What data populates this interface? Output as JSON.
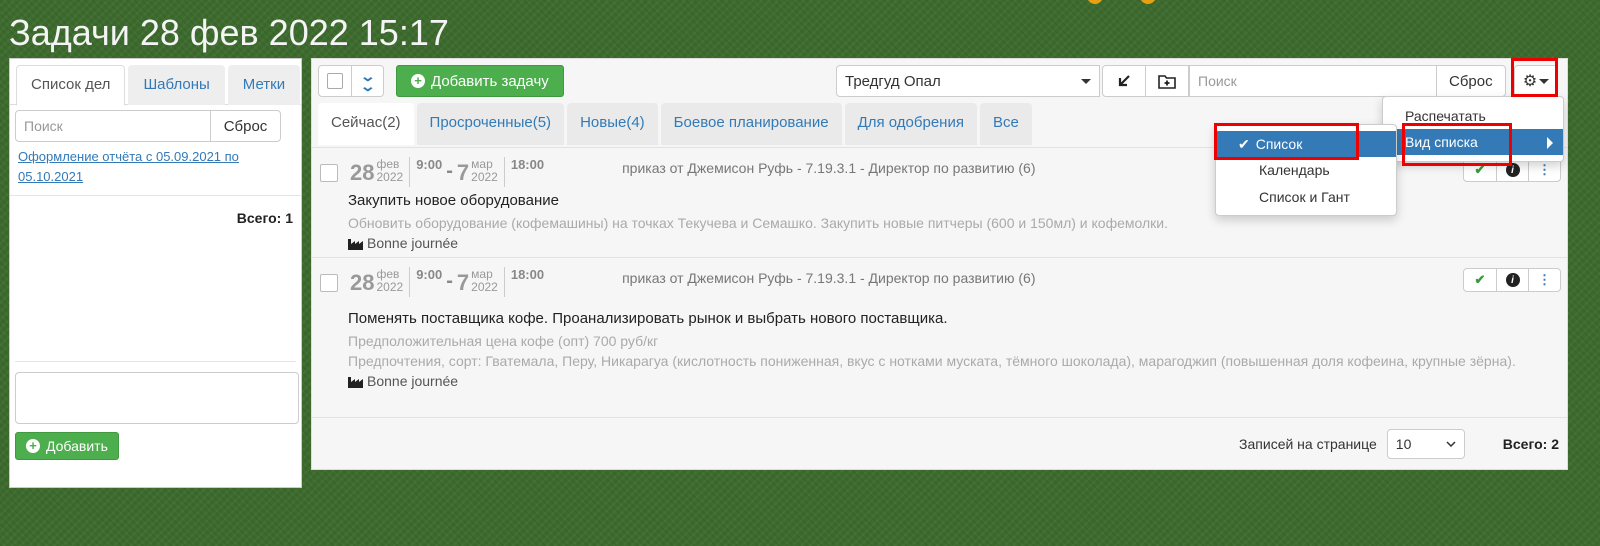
{
  "page_title": "Задачи 28 фев 2022 15:17",
  "left": {
    "tabs": [
      "Список дел",
      "Шаблоны",
      "Метки"
    ],
    "search_placeholder": "Поиск",
    "reset_label": "Сброс",
    "link_text": "Оформление отчёта с 05.09.2021 по 05.10.2021",
    "total": "Всего: 1",
    "add_label": "Добавить"
  },
  "toolbar": {
    "add_task_label": "Добавить задачу",
    "person": "Тредгуд Опал",
    "search_placeholder": "Поиск",
    "reset_label": "Сброс"
  },
  "tabs": [
    "Сейчас(2)",
    "Просроченные(5)",
    "Новые(4)",
    "Боевое планирование",
    "Для одобрения",
    "Все"
  ],
  "tasks": [
    {
      "day_start": "28",
      "month_start": "фев",
      "year_start": "2022",
      "time_start": "9:00",
      "day_end": "7",
      "month_end": "мар",
      "year_end": "2022",
      "time_end": "18:00",
      "order": "приказ от Джемисон Руфь - 7.19.3.1 - Директор по развитию (6)",
      "title": "Закупить новое оборудование",
      "desc": "Обновить оборудование (кофемашины) на точках Текучева и Семашко. Закупить новые питчеры (600 и 150мл) и кофемолки.",
      "project": "Bonne journée"
    },
    {
      "day_start": "28",
      "month_start": "фев",
      "year_start": "2022",
      "time_start": "9:00",
      "day_end": "7",
      "month_end": "мар",
      "year_end": "2022",
      "time_end": "18:00",
      "order": "приказ от Джемисон Руфь - 7.19.3.1 - Директор по развитию (6)",
      "title": "Поменять поставщика кофе. Проанализировать рынок и выбрать нового поставщика.",
      "desc": "Предположительная цена кофе (опт) 700 руб/кг",
      "desc2": "Предпочтения, сорт: Гватемала, Перу, Никарагуа (кислотность пониженная, вкус с нотками муската, тёмного шоколада), марагоджип (повышенная доля кофеина, крупные зёрна).",
      "project": "Bonne journée"
    }
  ],
  "footer": {
    "per_page_label": "Записей на странице",
    "per_page_value": "10",
    "total": "Всего: 2"
  },
  "menu": {
    "print": "Распечатать",
    "view": "Вид списка",
    "sub": [
      "Список",
      "Календарь",
      "Список и Гант"
    ]
  },
  "colors": {
    "accent": "#337ab7",
    "green": "#4cae4c",
    "highlight": "#e00000",
    "background": "#3d6b2e"
  }
}
